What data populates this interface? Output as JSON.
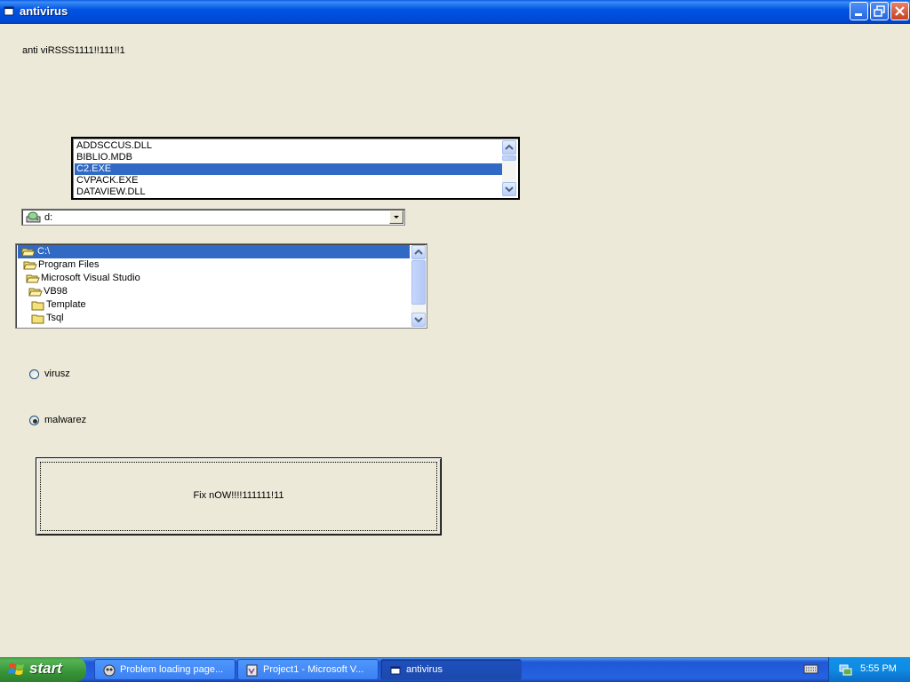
{
  "window": {
    "title": "antivirus"
  },
  "form": {
    "heading": "anti viRSSS1111!!111!!1",
    "file_list": {
      "items": [
        "ADDSCCUS.DLL",
        "BIBLIO.MDB",
        "C2.EXE",
        "CVPACK.EXE",
        "DATAVIEW.DLL"
      ],
      "selected_index": 2
    },
    "drive_combo": {
      "value": "d:"
    },
    "dir_list": {
      "items": [
        "C:\\",
        "Program Files",
        "Microsoft Visual Studio",
        "VB98",
        "Template",
        "Tsql"
      ],
      "selected_index": 0
    },
    "radio_virusz": {
      "label": "virusz",
      "checked": false
    },
    "radio_malwarez": {
      "label": "malwarez",
      "checked": true
    },
    "fix_button": {
      "label": "Fix nOW!!!!111111!11"
    }
  },
  "taskbar": {
    "start_label": "start",
    "tasks": [
      {
        "label": "Problem loading page..."
      },
      {
        "label": "Project1 - Microsoft V..."
      },
      {
        "label": "antivirus"
      }
    ],
    "clock": "5:55 PM"
  },
  "colors": {
    "selection": "#316ac5",
    "window_bg": "#ece9d8",
    "titlebar": "#0054e3"
  }
}
